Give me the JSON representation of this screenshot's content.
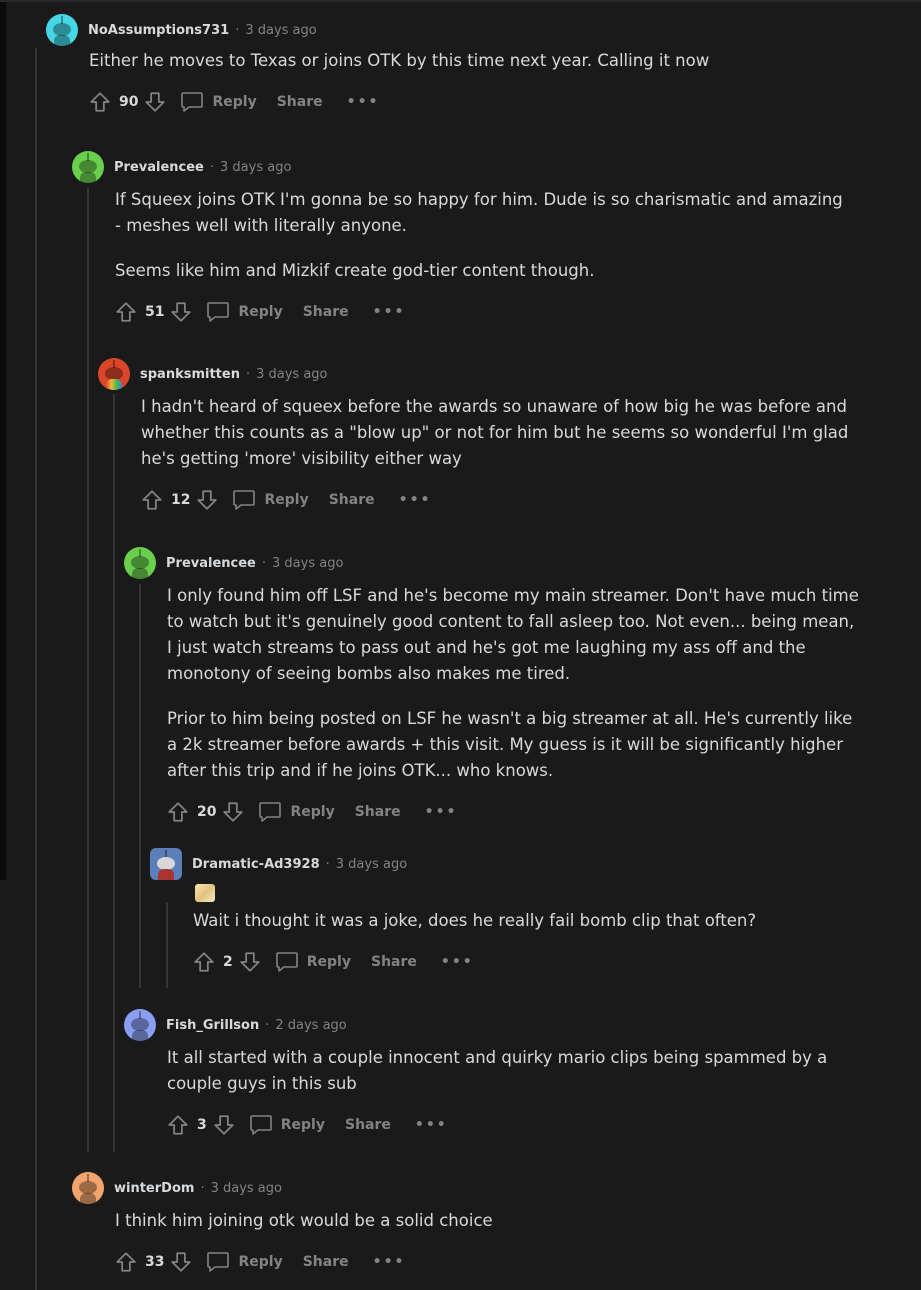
{
  "colors": {
    "background": "#1a1a1b",
    "text": "#d7dadc",
    "meta": "#818384",
    "thread_line": "#343536"
  },
  "comments": [
    {
      "author": "NoAssumptions731",
      "time": "3 days ago",
      "avatar_color": "#46d6e6",
      "paragraphs": [
        "Either he moves to Texas or joins OTK by this time next year. Calling it now"
      ],
      "score": "90"
    },
    {
      "author": "Prevalencee",
      "time": "3 days ago",
      "avatar_color": "#6bcf4e",
      "paragraphs": [
        "If Squeex joins OTK I'm gonna be so happy for him. Dude is so charismatic and amazing - meshes well with literally anyone.",
        "Seems like him and Mizkif create god-tier content though."
      ],
      "score": "51"
    },
    {
      "author": "spanksmitten",
      "time": "3 days ago",
      "avatar_color": "#d9462a",
      "paragraphs": [
        "I hadn't heard of squeex before the awards so unaware of how big he was before and whether this counts as a \"blow up\" or not for him but he seems so wonderful I'm glad he's getting 'more' visibility either way"
      ],
      "score": "12"
    },
    {
      "author": "Prevalencee",
      "time": "3 days ago",
      "avatar_color": "#6bcf4e",
      "paragraphs": [
        "I only found him off LSF and he's become my main streamer. Don't have much time to watch but it's genuinely good content to fall asleep too. Not even... being mean, I just watch streams to pass out and he's got me laughing my ass off and the monotony of seeing bombs also makes me tired.",
        "Prior to him being posted on LSF he wasn't a big streamer at all. He's currently like a 2k streamer before awards + this visit. My guess is it will be significantly higher after this trip and if he joins OTK... who knows."
      ],
      "score": "20"
    },
    {
      "author": "Dramatic-Ad3928",
      "time": "3 days ago",
      "avatar_color": "#5b7fb8",
      "paragraphs": [
        "Wait i thought it was a joke, does he really fail bomb clip that often?"
      ],
      "score": "2"
    },
    {
      "author": "Fish_Grillson",
      "time": "2 days ago",
      "avatar_color": "#8a9ef2",
      "paragraphs": [
        "It all started with a couple innocent and quirky mario clips being spammed by a couple guys in this sub"
      ],
      "score": "3"
    },
    {
      "author": "winterDom",
      "time": "3 days ago",
      "avatar_color": "#f2a46c",
      "paragraphs": [
        "I think him joining otk would be a solid choice"
      ],
      "score": "33"
    }
  ],
  "labels": {
    "reply": "Reply",
    "share": "Share",
    "more": "•••",
    "separator": "·"
  }
}
